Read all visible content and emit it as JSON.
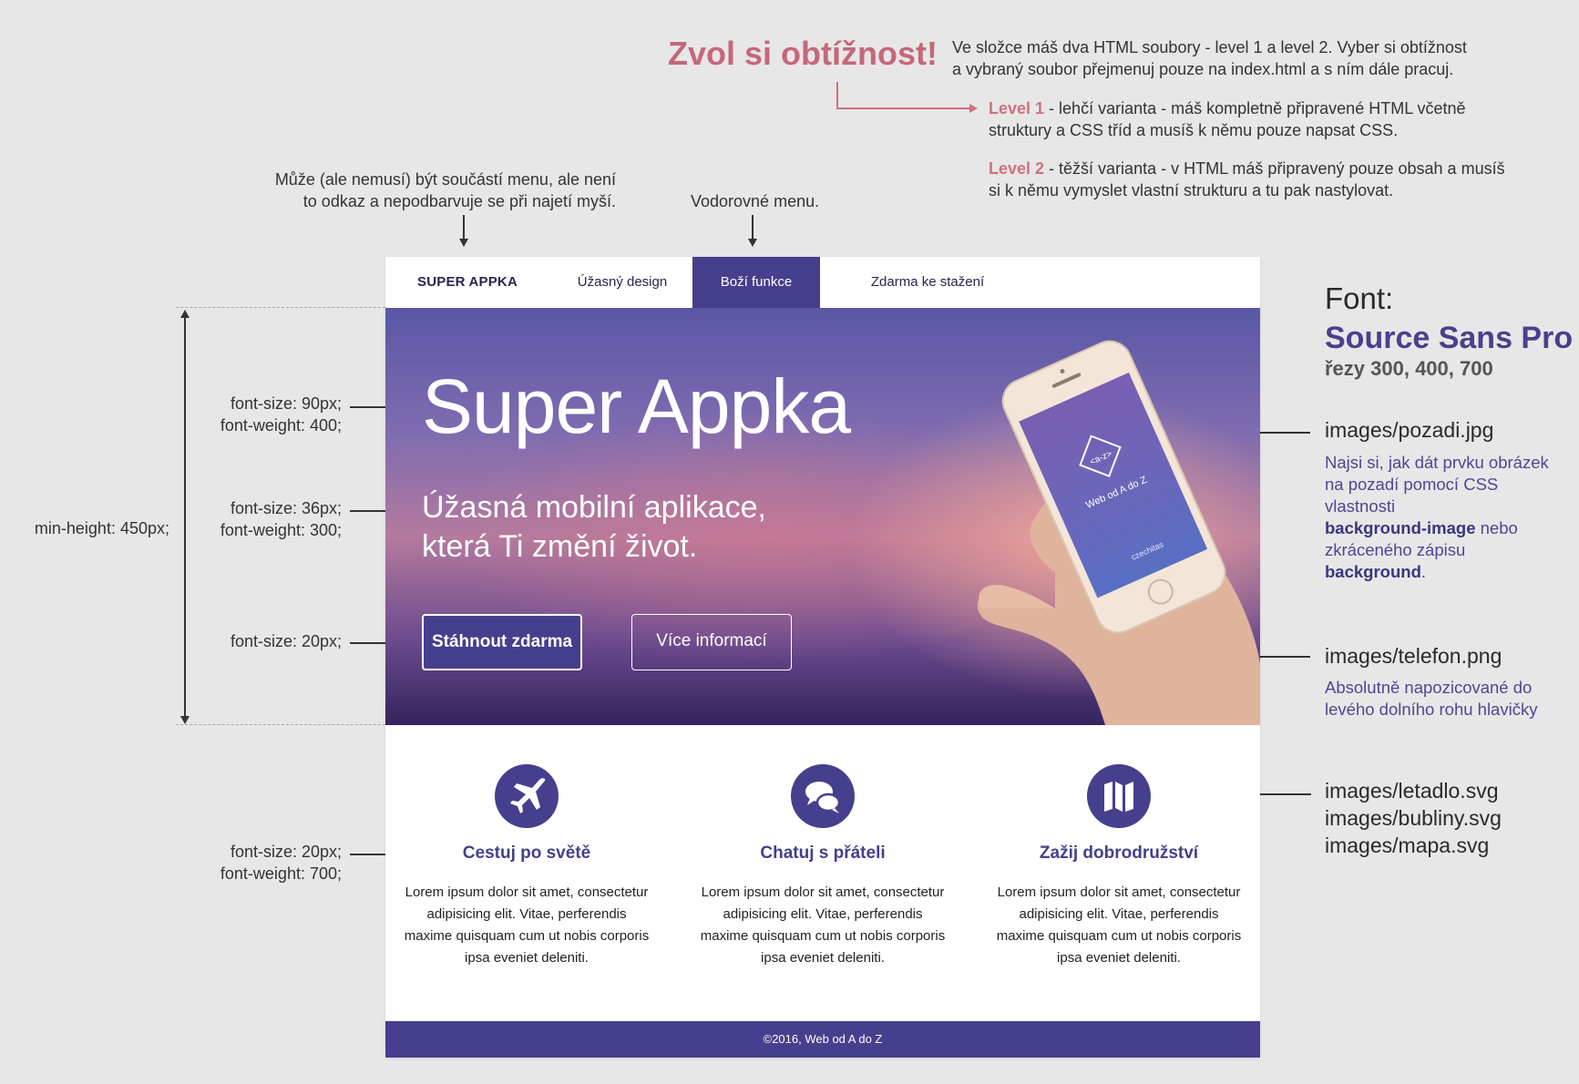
{
  "notes": {
    "difficulty_title": "Zvol si obtížnost!",
    "intro_line1": "Ve složce máš dva HTML soubory - level 1 a level 2. Vyber si obtížnost",
    "intro_line2": "a vybraný soubor přejmenuj pouze na index.html a s ním dále pracuj.",
    "level1_label": "Level 1",
    "level1_line1": " - lehčí varianta - máš kompletně připravené HTML včetně",
    "level1_line2": "struktury a CSS tříd a musíš k němu pouze napsat CSS.",
    "level2_label": "Level 2",
    "level2_line1": " - těžší varianta - v HTML máš připravený pouze obsah a musíš",
    "level2_line2": "si k němu vymyslet vlastní strukturu a tu pak nastylovat.",
    "brand_note_line1": "Může (ale nemusí) být součástí menu, ale není",
    "brand_note_line2": "to odkaz a nepodbarvuje se při najetí myší.",
    "menu_note": "Vodorovné menu."
  },
  "font_info": {
    "label": "Font:",
    "name": "Source Sans Pro",
    "weights": "řezy 300, 400, 700"
  },
  "right_notes": {
    "bg_file": "images/pozadi.jpg",
    "bg_hint_line1": "Najsi si, jak dát prvku obrázek",
    "bg_hint_line2": "na pozadí pomocí CSS vlastnosti",
    "bg_hint_bold1": "background-image",
    "bg_hint_line3": " nebo",
    "bg_hint_line4": "zkráceného zápisu ",
    "bg_hint_bold2": "background",
    "bg_hint_end": ".",
    "phone_file": "images/telefon.png",
    "phone_hint_line1": "Absolutně napozicované do",
    "phone_hint_line2": "levého dolního rohu hlavičky",
    "icon_file1": "images/letadlo.svg",
    "icon_file2": "images/bubliny.svg",
    "icon_file3": "images/mapa.svg"
  },
  "left_specs": {
    "title_size": "font-size: 90px;",
    "title_weight": "font-weight: 400;",
    "sub_size": "font-size: 36px;",
    "sub_weight": "font-weight: 300;",
    "button_size": "font-size: 20px;",
    "min_height": "min-height: 450px;",
    "feature_size": "font-size: 20px;",
    "feature_weight": "font-weight: 700;"
  },
  "site": {
    "nav": {
      "brand": "SUPER APPKA",
      "items": [
        "Úžasný design",
        "Boží funkce",
        "Zdarma ke stažení"
      ],
      "active_index": 1
    },
    "hero": {
      "title": "Super Appka",
      "subtitle_line1": "Úžasná mobilní aplikace,",
      "subtitle_line2": "která Ti změní život.",
      "primary_button": "Stáhnout zdarma",
      "secondary_button": "Více informací",
      "phone_screen_logo": "<a-z>",
      "phone_screen_text": "Web od A do Z",
      "phone_screen_brand": "czechitas"
    },
    "features": [
      {
        "icon": "airplane-icon",
        "title": "Cestuj po světě",
        "text": "Lorem ipsum dolor sit amet, consectetur adipisicing elit. Vitae, perferendis maxime quisquam cum ut nobis corporis ipsa eveniet deleniti."
      },
      {
        "icon": "chat-bubbles-icon",
        "title": "Chatuj s přáteli",
        "text": "Lorem ipsum dolor sit amet, consectetur adipisicing elit. Vitae, perferendis maxime quisquam cum ut nobis corporis ipsa eveniet deleniti."
      },
      {
        "icon": "map-icon",
        "title": "Zažij dobrodružství",
        "text": "Lorem ipsum dolor sit amet, consectetur adipisicing elit. Vitae, perferendis maxime quisquam cum ut nobis corporis ipsa eveniet deleniti."
      }
    ],
    "footer": "©2016, Web od A do Z"
  },
  "colors": {
    "accent": "#463f8d",
    "note_red": "#c4687a",
    "page_bg": "#e8e7e7"
  }
}
